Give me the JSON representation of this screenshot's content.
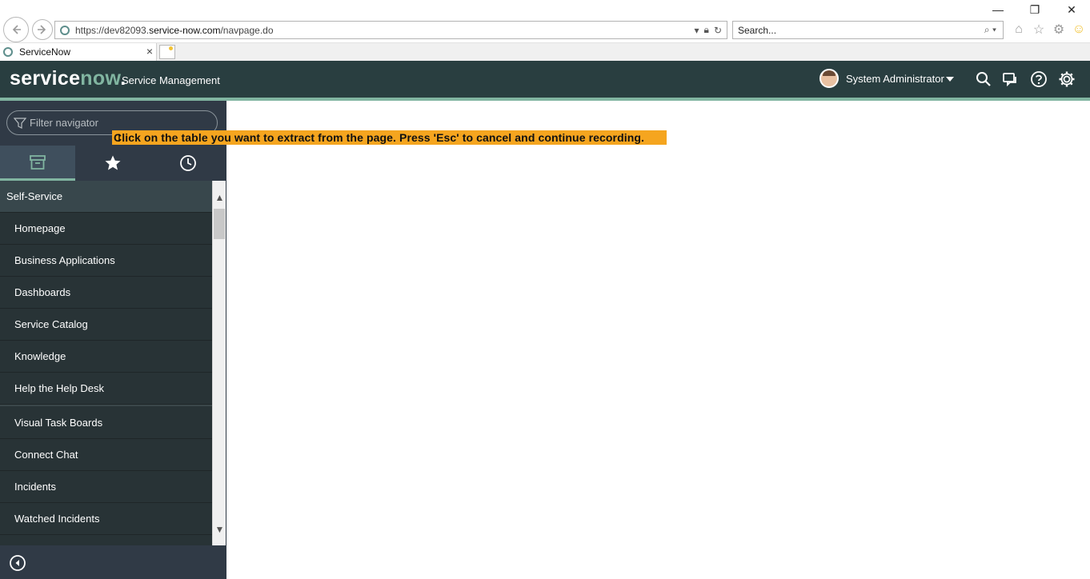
{
  "browser": {
    "url_prefix": "https://dev82093.",
    "url_domain": "service-now.com",
    "url_path": "/navpage.do",
    "search_placeholder": "Search...",
    "tab_title": "ServiceNow",
    "tab_close": "×",
    "window_minimize": "—",
    "window_restore": "❐",
    "window_close": "✕"
  },
  "header": {
    "logo_text_service": "service",
    "logo_text_now": "now",
    "logo_dot": ".",
    "app_title": "Service Management",
    "user_name": "System Administrator"
  },
  "sidebar": {
    "filter_placeholder": "Filter navigator",
    "items": [
      {
        "label": "Self-Service",
        "type": "section"
      },
      {
        "label": "Homepage"
      },
      {
        "label": "Business Applications"
      },
      {
        "label": "Dashboards"
      },
      {
        "label": "Service Catalog"
      },
      {
        "label": "Knowledge"
      },
      {
        "label": "Help the Help Desk"
      },
      {
        "label": "Visual Task Boards"
      },
      {
        "label": "Connect Chat"
      },
      {
        "label": "Incidents"
      },
      {
        "label": "Watched Incidents"
      }
    ]
  },
  "overlay": {
    "notice_text": "Click on the table you want to extract from the page. Press 'Esc' to cancel and continue recording."
  },
  "colors": {
    "header_bg": "#293e40",
    "accent": "#81b5a1",
    "sidebar_bg": "#303a46",
    "notice_bg": "#f5a51f"
  }
}
